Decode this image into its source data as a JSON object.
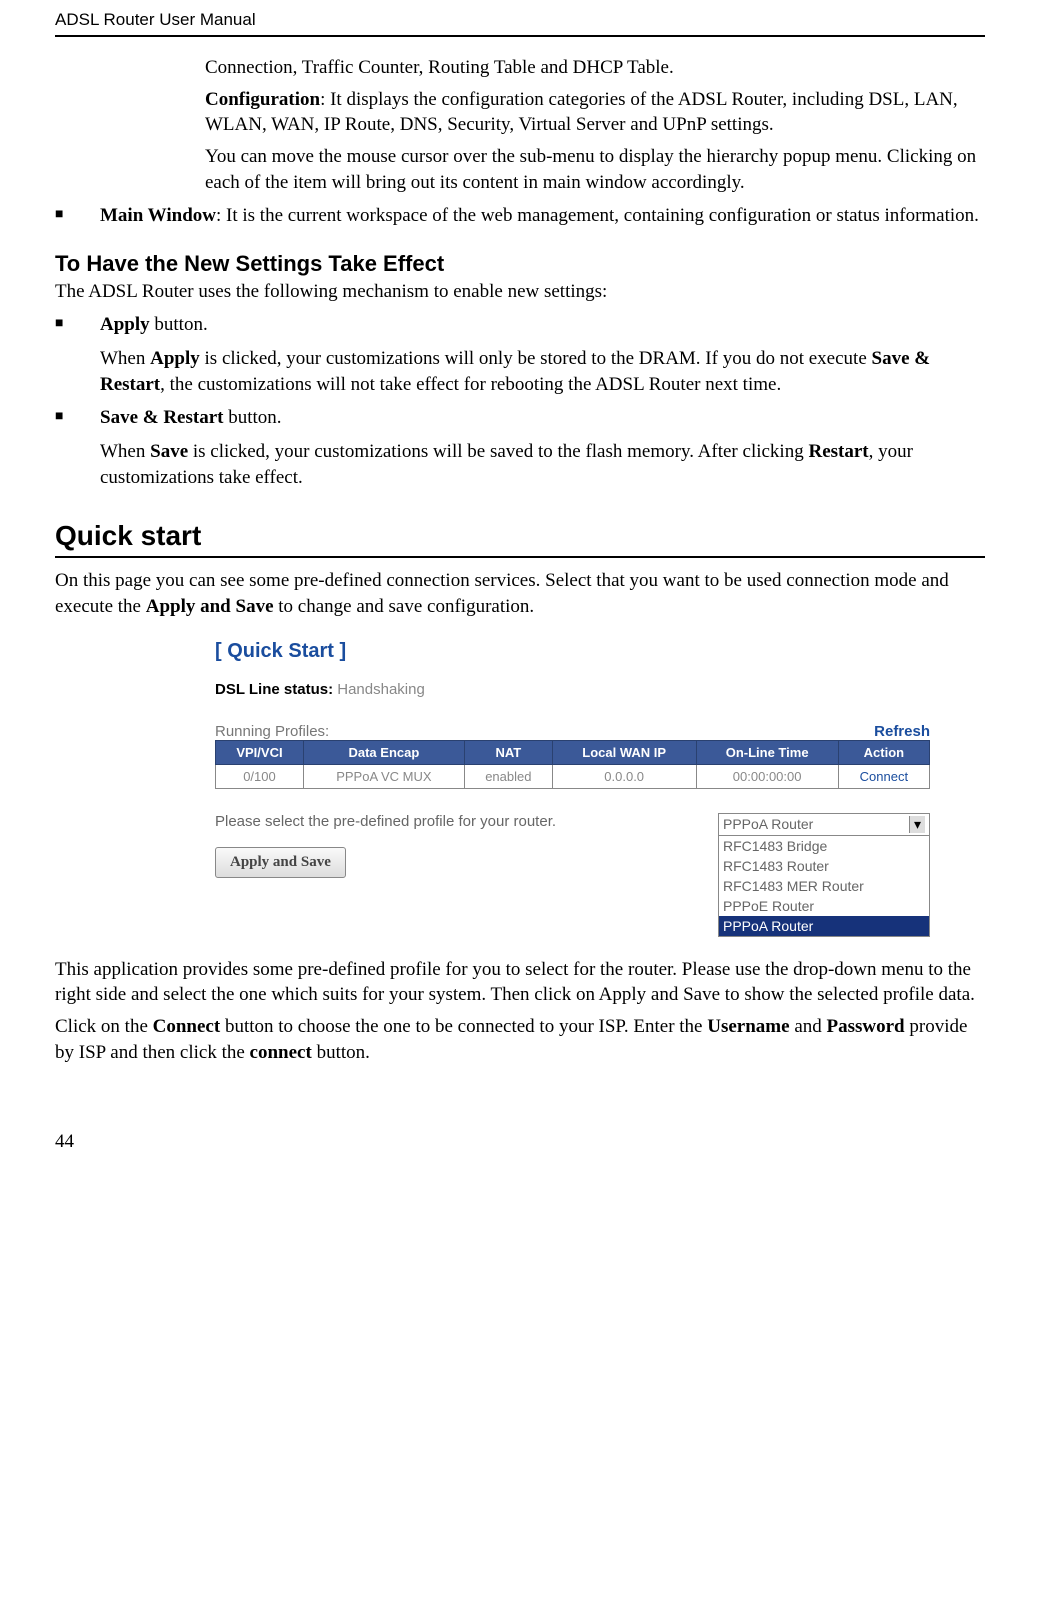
{
  "header": {
    "title": "ADSL Router User Manual"
  },
  "intro": {
    "connection_line": "Connection, Traffic Counter, Routing Table and DHCP Table.",
    "config_label": "Configuration",
    "config_text": ": It displays the configuration categories of the ADSL Router, including DSL, LAN, WLAN, WAN, IP Route, DNS, Security, Virtual Server and UPnP settings.",
    "mouse_text": "You can move the mouse cursor over the sub-menu to display the hierarchy popup menu. Clicking on each of the item will bring out its content in main window accordingly."
  },
  "main_window": {
    "lead": "Main Window",
    "rest": ": It is the current workspace of the web management, containing configuration or status information."
  },
  "settings_effect": {
    "heading": "To Have the New Settings Take Effect",
    "intro": "The ADSL Router uses the following mechanism to enable new settings:",
    "apply_lead": "Apply",
    "apply_rest": " button.",
    "apply_detail_1": "When ",
    "apply_detail_b1": "Apply",
    "apply_detail_2": " is clicked, your customizations will only be stored to the DRAM. If you do not execute ",
    "apply_detail_b2": "Save & Restart",
    "apply_detail_3": ", the customizations will not take effect for rebooting the ADSL Router next time.",
    "save_lead": "Save & Restart",
    "save_rest": " button.",
    "save_detail_1": "When ",
    "save_detail_b1": "Save",
    "save_detail_2": " is clicked, your customizations will be saved to the flash memory. After clicking ",
    "save_detail_b2": "Restart",
    "save_detail_3": ", your customizations take effect."
  },
  "quickstart": {
    "heading": "Quick start",
    "intro_1": "On this page you can see some pre-defined connection services. Select that you want to be used connection mode and execute the ",
    "intro_b": "Apply and Save",
    "intro_2": " to change and save configuration.",
    "after_1": "This application provides some pre-defined profile for you to select for the router. Please use the drop-down menu to the right side and select the one which suits for your system. Then click on Apply and Save to show the selected profile data.",
    "after_2a": "Click on the ",
    "after_2b": "Connect",
    "after_2c": " button to choose the one to be connected to your ISP. Enter the ",
    "after_2d": "Username",
    "after_2e": " and ",
    "after_2f": "Password",
    "after_2g": " provide by ISP and then click the ",
    "after_2h": "connect",
    "after_2i": " button."
  },
  "figure": {
    "title": "[ Quick Start ]",
    "dsl_label": "DSL Line status:",
    "dsl_value": " Handshaking",
    "running_label": "Running Profiles:",
    "refresh": "Refresh",
    "headers": [
      "VPI/VCI",
      "Data Encap",
      "NAT",
      "Local WAN IP",
      "On-Line Time",
      "Action"
    ],
    "row": [
      "0/100",
      "PPPoA  VC MUX",
      "enabled",
      "0.0.0.0",
      "00:00:00:00",
      "Connect"
    ],
    "select_label": "Please select the pre-defined profile for your router.",
    "select_selected": "PPPoA Router",
    "select_options": [
      "RFC1483 Bridge",
      "RFC1483 Router",
      "RFC1483 MER Router",
      "PPPoE Router",
      "PPPoA Router"
    ],
    "apply_button": "Apply and Save"
  },
  "page_number": "44"
}
